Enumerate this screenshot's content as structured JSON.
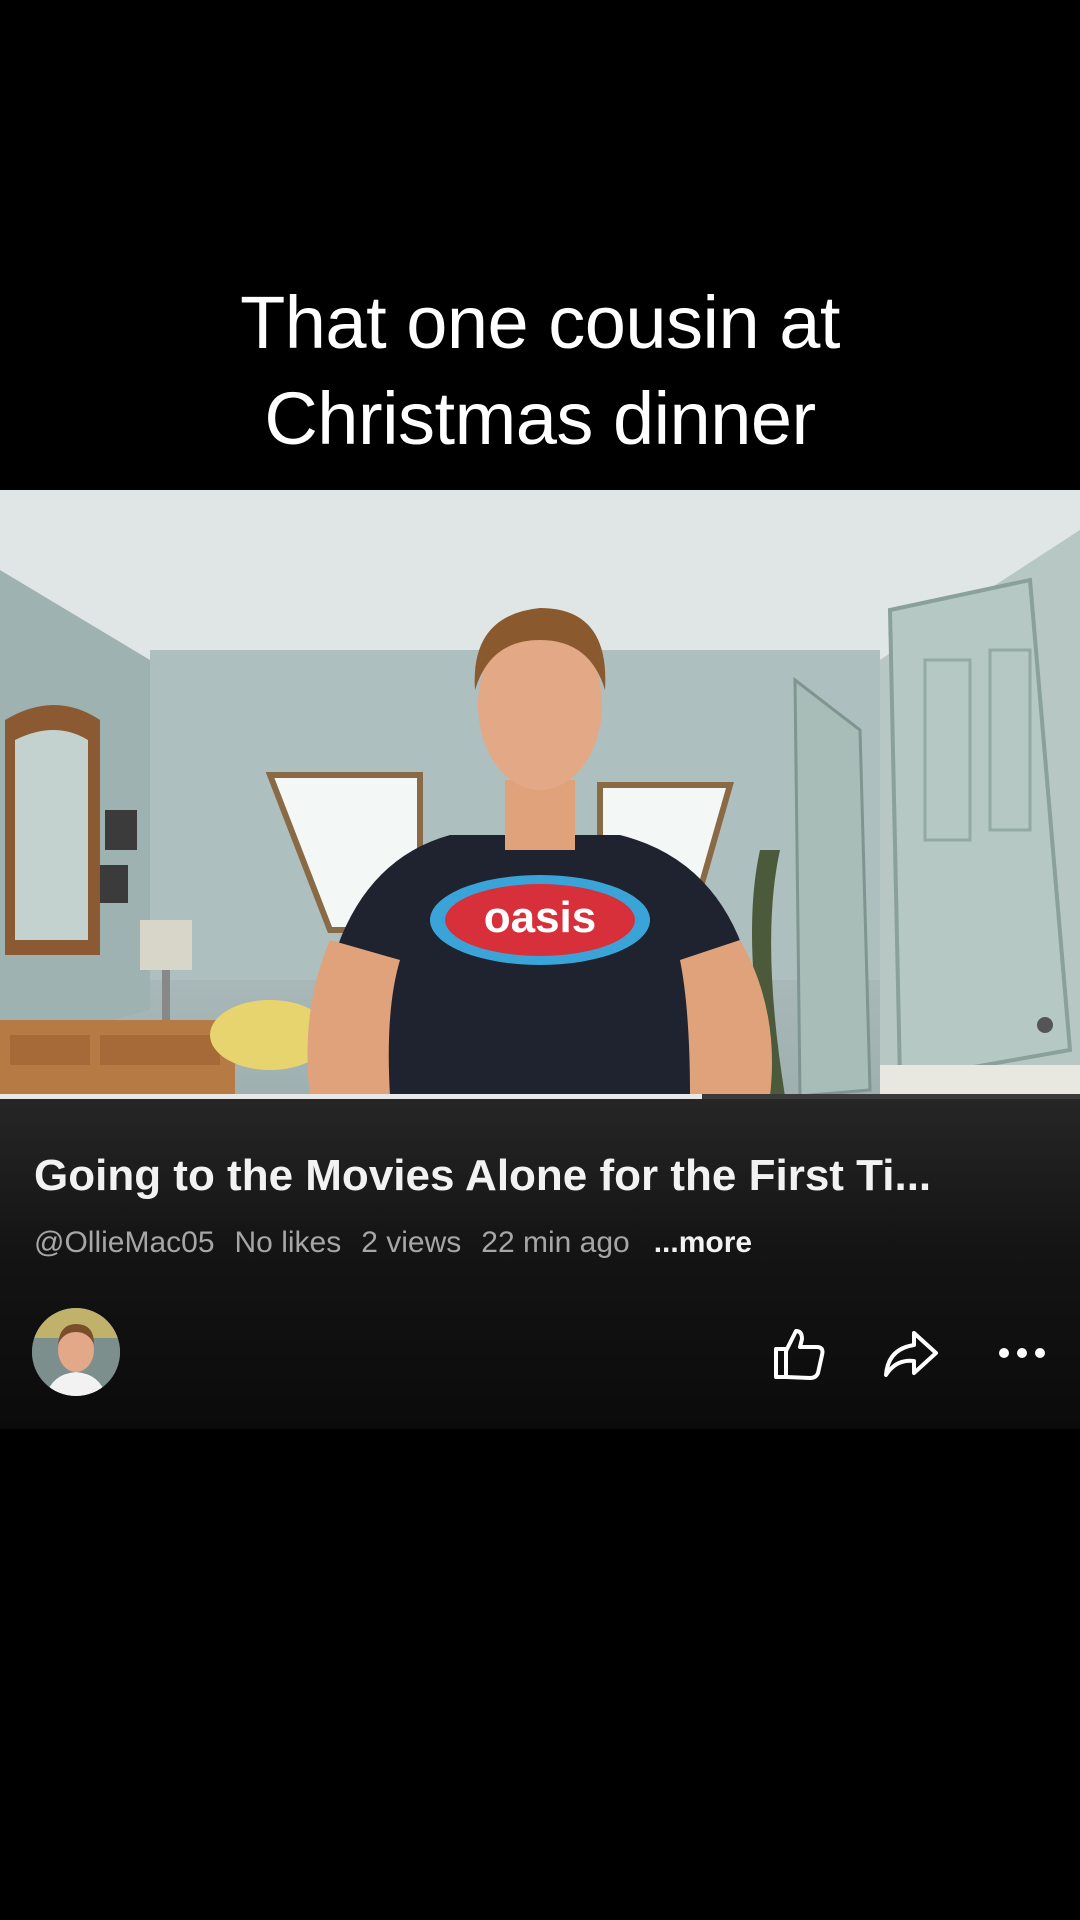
{
  "overlay_caption": {
    "line1": "That one cousin at",
    "line2": "Christmas dinner"
  },
  "video": {
    "shirt_text": "oasis",
    "progress_fraction": 0.65
  },
  "info": {
    "title": "Going to the Movies Alone for the First Ti...",
    "channel": "@OllieMac05",
    "likes": "No likes",
    "views": "2 views",
    "age": "22 min ago",
    "more_label": "...more"
  },
  "actions": {
    "like_icon": "thumbs-up-icon",
    "share_icon": "share-arrow-icon",
    "more_icon": "more-dots-icon"
  }
}
